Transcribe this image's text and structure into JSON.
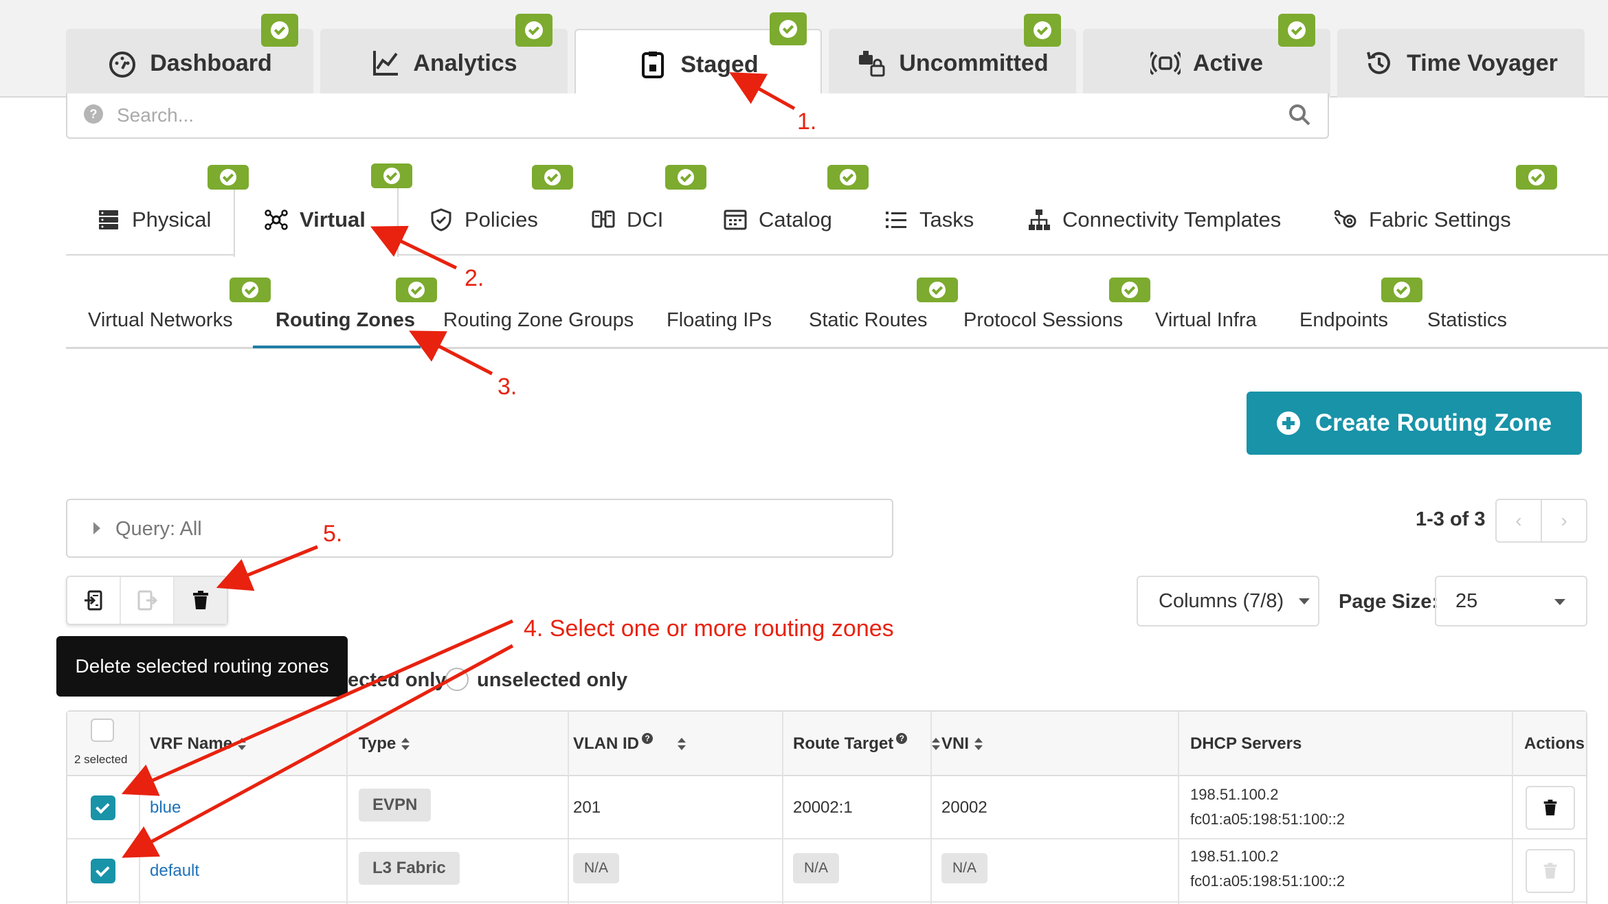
{
  "top_tabs": [
    {
      "label": "Dashboard",
      "icon": "dashboard-gauge-icon"
    },
    {
      "label": "Analytics",
      "icon": "line-chart-icon"
    },
    {
      "label": "Staged",
      "icon": "staged-clipboard-icon",
      "active": true
    },
    {
      "label": "Uncommitted",
      "icon": "uncommitted-lock-icon"
    },
    {
      "label": "Active",
      "icon": "broadcast-icon"
    },
    {
      "label": "Time Voyager",
      "icon": "history-icon"
    }
  ],
  "search": {
    "placeholder": "Search..."
  },
  "blueprint_tabs": [
    {
      "label": "Physical",
      "icon": "server-icon"
    },
    {
      "label": "Virtual",
      "icon": "network-nodes-icon",
      "active": true
    },
    {
      "label": "Policies",
      "icon": "shield-icon"
    },
    {
      "label": "DCI",
      "icon": "dci-icon"
    },
    {
      "label": "Catalog",
      "icon": "catalog-icon"
    },
    {
      "label": "Tasks",
      "icon": "list-icon"
    },
    {
      "label": "Connectivity Templates",
      "icon": "hierarchy-icon"
    },
    {
      "label": "Fabric Settings",
      "icon": "fabric-settings-icon"
    }
  ],
  "virtual_tabs": [
    {
      "label": "Virtual Networks"
    },
    {
      "label": "Routing Zones",
      "active": true
    },
    {
      "label": "Routing Zone Groups"
    },
    {
      "label": "Floating IPs"
    },
    {
      "label": "Static Routes"
    },
    {
      "label": "Protocol Sessions"
    },
    {
      "label": "Virtual Infra"
    },
    {
      "label": "Endpoints"
    },
    {
      "label": "Statistics"
    }
  ],
  "create_button": "Create Routing Zone",
  "query": "Query: All",
  "pagination": {
    "text": "1-3 of 3"
  },
  "tooltip": "Delete selected routing zones",
  "columns_dropdown": "Columns (7/8)",
  "page_size": {
    "label": "Page Size:",
    "value": "25"
  },
  "filter": {
    "selected_partial": "ected only",
    "unselected": "unselected only"
  },
  "table": {
    "selected_count": "2 selected",
    "headers": [
      "VRF Name",
      "Type",
      "VLAN ID",
      "Route Target",
      "VNI",
      "DHCP Servers",
      "Actions"
    ],
    "rows": [
      {
        "vrf": "blue",
        "type": "EVPN",
        "vlan": "201",
        "route_target": "20002:1",
        "vni": "20002",
        "dhcp": [
          "198.51.100.2",
          "fc01:a05:198:51:100::2"
        ],
        "checked": true
      },
      {
        "vrf": "default",
        "type": "L3 Fabric",
        "vlan": "N/A",
        "route_target": "N/A",
        "vni": "N/A",
        "dhcp": [
          "198.51.100.2",
          "fc01:a05:198:51:100::2"
        ],
        "checked": true
      }
    ]
  },
  "annotations": {
    "a1": "1.",
    "a2": "2.",
    "a3": "3.",
    "a4": "4. Select one or more routing zones",
    "a5": "5."
  },
  "colors": {
    "accent": "#1893a8",
    "check_green": "#7cab2f",
    "annotation_red": "#e8220f",
    "link_blue": "#1f72b8"
  }
}
